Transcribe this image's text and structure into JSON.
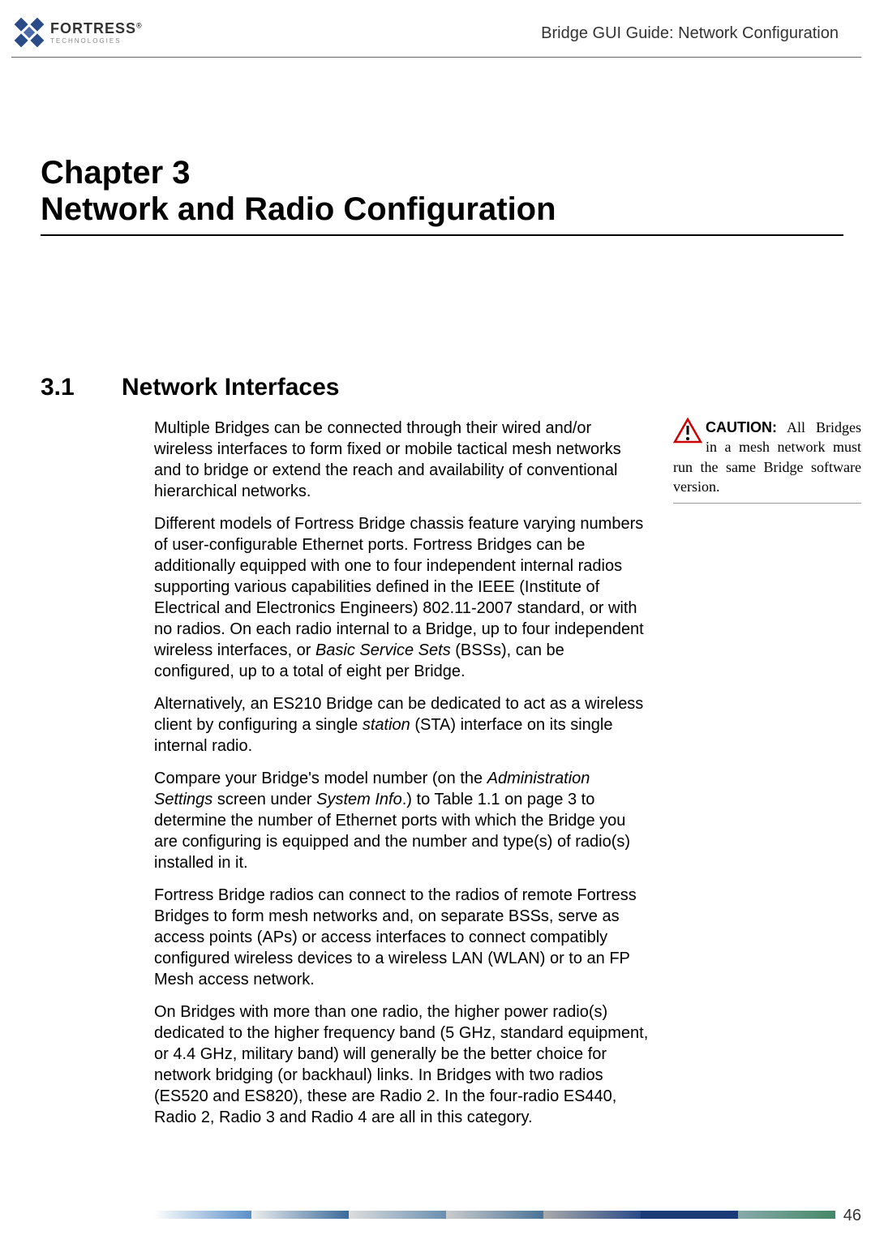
{
  "header": {
    "logo_main": "FORTRESS",
    "logo_sub": "TECHNOLOGIES",
    "guide_title": "Bridge GUI Guide: Network Configuration"
  },
  "chapter": {
    "line1": "Chapter 3",
    "line2": "Network and Radio Configuration"
  },
  "section": {
    "number": "3.1",
    "title": "Network Interfaces"
  },
  "paragraphs": {
    "p1": "Multiple Bridges can be connected through their wired and/or wireless interfaces to form fixed or mobile tactical mesh networks and to bridge or extend the reach and availability of conventional hierarchical networks.",
    "p2a": "Different models of Fortress Bridge chassis feature varying numbers of user-configurable Ethernet ports. Fortress Bridges can be additionally equipped with one to four independent internal radios supporting various capabilities defined in the IEEE (Institute of Electrical and Electronics Engineers) 802.11-2007 standard, or with no radios. On each radio internal to a Bridge, up to four independent wireless interfaces, or ",
    "p2b": "Basic Service Sets",
    "p2c": " (BSSs), can be configured, up to a total of eight per Bridge.",
    "p3a": "Alternatively, an ES210 Bridge can be dedicated to act as a wireless client by configuring a single ",
    "p3b": "station",
    "p3c": " (STA) interface on its single internal radio.",
    "p4a": "Compare your Bridge's model number (on the ",
    "p4b": "Administration Settings",
    "p4c": " screen under ",
    "p4d": "System Info",
    "p4e": ".) to Table 1.1 on page 3 to determine the number of Ethernet ports with which the Bridge you are configuring is equipped and the number and type(s) of radio(s) installed in it.",
    "p5": "Fortress Bridge radios can connect to the radios of remote Fortress Bridges to form mesh networks and, on separate BSSs, serve as access points (APs) or access interfaces to connect compatibly configured wireless devices to a wireless LAN (WLAN) or to an FP Mesh access network.",
    "p6": "On Bridges with more than one radio, the higher power radio(s) dedicated to the higher frequency band (5 GHz, standard equipment, or 4.4 GHz, military band) will generally be the better choice for network bridging (or backhaul) links. In Bridges with two radios (ES520 and ES820), these are Radio 2. In the four-radio ES440, Radio 2, Radio 3 and Radio 4 are all in this category."
  },
  "caution": {
    "label": "CAUTION:",
    "text": " All Bridges in a mesh network must run the same Bridge software version."
  },
  "page_number": "46",
  "logo_sup": "®"
}
